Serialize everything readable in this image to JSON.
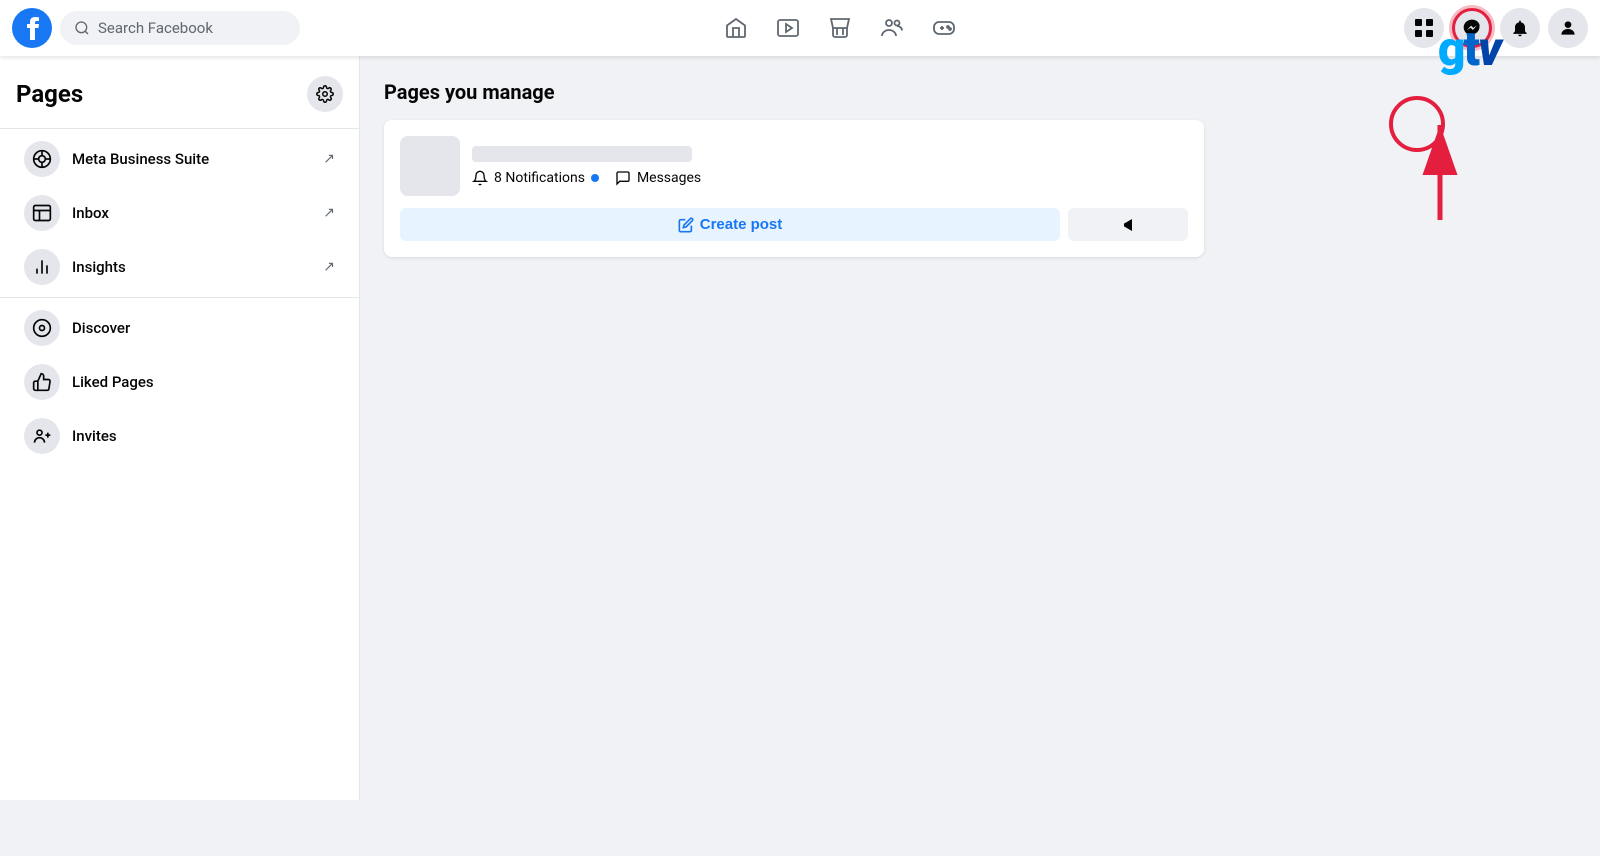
{
  "topNav": {
    "searchPlaceholder": "Search Facebook",
    "navIcons": [
      {
        "name": "home",
        "symbol": "⌂",
        "active": false
      },
      {
        "name": "watch",
        "symbol": "▶",
        "active": false
      },
      {
        "name": "marketplace",
        "symbol": "🏪",
        "active": false
      },
      {
        "name": "groups",
        "symbol": "👥",
        "active": false
      },
      {
        "name": "gaming",
        "symbol": "🎮",
        "active": false
      }
    ],
    "rightActions": [
      {
        "name": "grid-menu",
        "symbol": "⠿"
      },
      {
        "name": "messenger",
        "symbol": "💬",
        "highlighted": true
      },
      {
        "name": "notifications",
        "symbol": "🔔"
      }
    ]
  },
  "sidebar": {
    "title": "Pages",
    "gearLabel": "⚙",
    "items": [
      {
        "label": "Meta Business Suite",
        "icon": "◎",
        "hasArrow": true
      },
      {
        "label": "Inbox",
        "icon": "▤",
        "hasArrow": true
      },
      {
        "label": "Insights",
        "icon": "📊",
        "hasArrow": true
      },
      {
        "label": "Discover",
        "icon": "⊙",
        "hasArrow": false
      },
      {
        "label": "Liked Pages",
        "icon": "👍",
        "hasArrow": false
      },
      {
        "label": "Invites",
        "icon": "👤+",
        "hasArrow": false
      }
    ]
  },
  "main": {
    "sectionTitle": "Pages you manage",
    "pageCard": {
      "notifications": {
        "icon": "🔔",
        "count": "8",
        "label": "Notifications"
      },
      "messages": {
        "icon": "💬",
        "label": "Messages"
      },
      "createPostLabel": "Create post",
      "promoteIcon": "📢"
    }
  },
  "gtv": {
    "text": "gtv"
  }
}
